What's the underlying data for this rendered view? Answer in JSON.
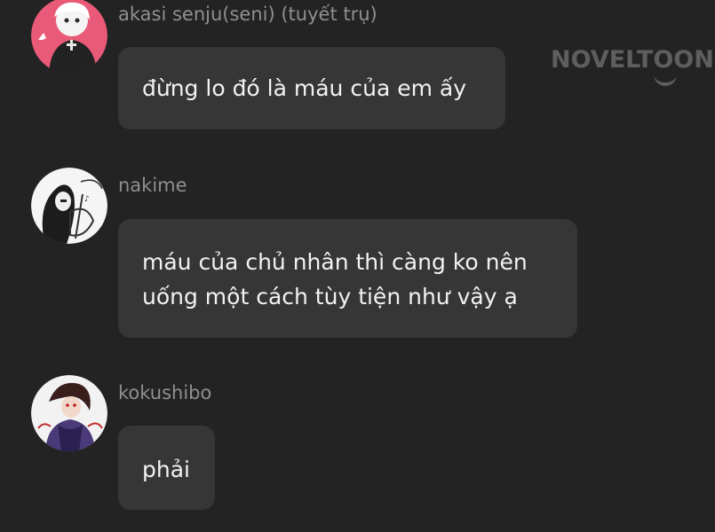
{
  "watermark": {
    "text": "NOVELTOON"
  },
  "messages": [
    {
      "sender": "akasi senju(seni) (tuyết trụ)",
      "lines": [
        "đừng lo đó là máu của em ấy"
      ]
    },
    {
      "sender": "nakime",
      "lines": [
        "máu của chủ nhân thì càng ko nên",
        "uống một cách tùy tiện như vậy ạ"
      ]
    },
    {
      "sender": "kokushibo",
      "lines": [
        "phải"
      ]
    }
  ],
  "colors": {
    "background": "#232323",
    "bubble": "#363636",
    "sender_name": "#8f8f8f",
    "message_text": "#f2f2f2",
    "watermark": "#5e5e5e"
  }
}
